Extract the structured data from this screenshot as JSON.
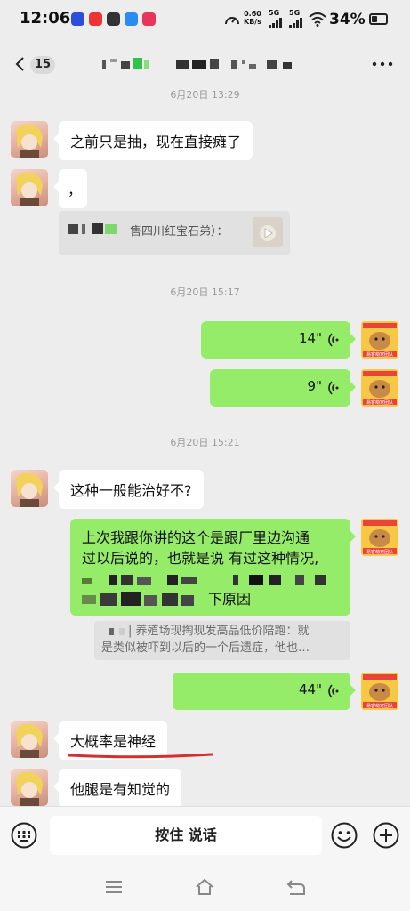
{
  "status_bar": {
    "time": "12:06",
    "net_speed_value": "0.60",
    "net_speed_unit": "KB/s",
    "signal_1": "5G",
    "signal_2": "5G",
    "battery": "34%"
  },
  "header": {
    "unread_count": "15",
    "title": "",
    "back_icon": "chevron-left-icon",
    "more_icon": "ellipsis-icon"
  },
  "messages": {
    "ts1": "6月20日 13:29",
    "m1": "之前只是抽，现在直接瘫了",
    "m2": "，",
    "quote1": "售四川红宝石弟）：",
    "ts2": "6月20日 15:17",
    "voice1": "14\"",
    "voice2": "9\"",
    "ts3": "6月20日 15:21",
    "m3": "这种一般能治好不?",
    "m4_line1": "上次我跟你讲的这个是跟厂里边沟通",
    "m4_line2": "过以后说的，也就是说 有过这种情况,",
    "m4_line4_tail": "下原因",
    "quote2_line1": "养殖场现掏现发高品低价陪跑：就",
    "quote2_line2": "是类似被吓到以后的一个后遗症，他也…",
    "voice3": "44\"",
    "m5": "大概率是神经",
    "m6": "他腿是有知觉的",
    "sticker_label": "易客萌宠团队"
  },
  "input": {
    "voice_label": "按住 说话"
  },
  "colors": {
    "bg": "#ededed",
    "bubble_self": "#95ec69",
    "bubble_other": "#ffffff",
    "underline": "#d32f2f"
  }
}
